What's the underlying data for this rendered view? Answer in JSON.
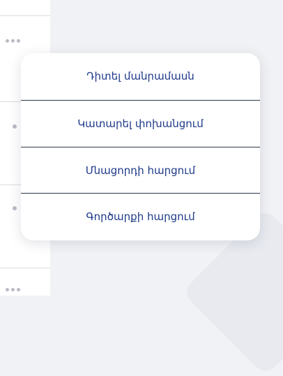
{
  "menu": {
    "items": [
      {
        "label": "Դիտել մանրամասն"
      },
      {
        "label": "Կատարել փոխանցում"
      },
      {
        "label": "Մնացորդի հարցում"
      },
      {
        "label": "Գործարքի հարցում"
      }
    ]
  },
  "icons": {
    "row_actions": "more-horizontal-icon",
    "row_marker": "dot-icon"
  },
  "colors": {
    "menu_text": "#1e3a8a",
    "background": "#f1f2f5",
    "divider": "#2d3748",
    "dots": "#b9bcc4"
  }
}
